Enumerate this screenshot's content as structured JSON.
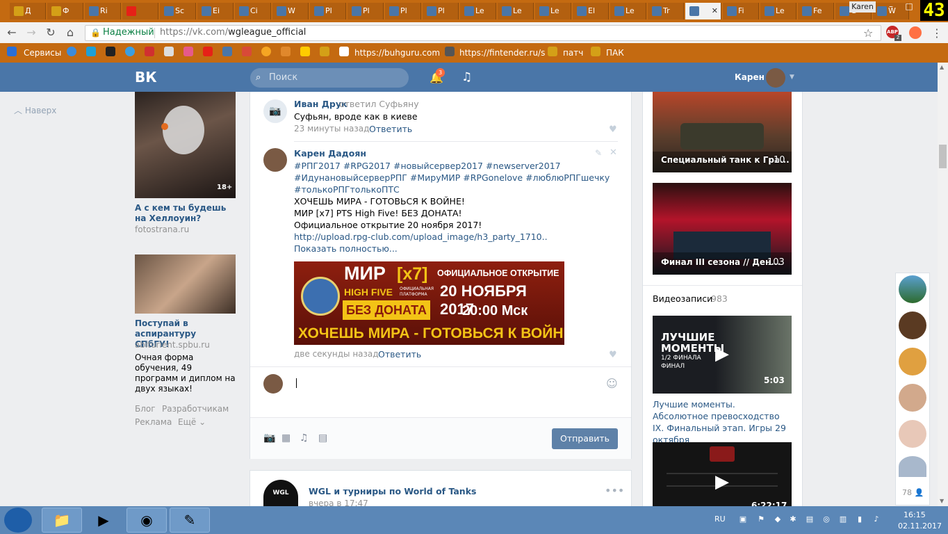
{
  "browser": {
    "tabs": [
      "Д",
      "Ф",
      "Rі",
      "",
      "Sc",
      "Ei",
      "Ci",
      "W",
      "Pl",
      "Pl",
      "Pl",
      "Pl",
      "Le",
      "Le",
      "Le",
      "El",
      "Le",
      "Tr",
      "",
      "Fi",
      "Le",
      "Fe",
      "G",
      "W"
    ],
    "window_user": "Karen",
    "corner_counter": "43",
    "secure_label": "Надежный",
    "url_host": "https://vk.com/",
    "url_path": "wgleague_official",
    "abp_badge": "ABP",
    "abp_count": "2"
  },
  "bookmarks": {
    "services": "Сервисы",
    "buhguru": "https://buhguru.com",
    "fintender": "https://fintender.ru/s",
    "patch": "патч",
    "pak": "ПАК"
  },
  "vk_header": {
    "logo": "ВК",
    "search_placeholder": "Поиск",
    "notif_count": "3",
    "user_name": "Карен"
  },
  "left": {
    "back_to_top": "Наверх",
    "ad1": {
      "badge": "18+",
      "title": "А с кем ты будешь на Хеллоуин?",
      "source": "fotostrana.ru"
    },
    "ad2": {
      "title": "Поступай в аспирантуру СПбГУ!",
      "source": "abiturient.spbu.ru",
      "body": "Очная форма обучения, 49 программ и диплом на двух языках!"
    },
    "footer": {
      "blog": "Блог",
      "dev": "Разработчикам",
      "ads": "Реклама",
      "more": "Ещё"
    }
  },
  "comments": {
    "c1": {
      "author": "Иван Друк",
      "action": "ответил Суфьяну",
      "text": "Суфьян, вроде как в киеве",
      "time": "23 минуты назад",
      "reply": "Ответить"
    },
    "c2": {
      "author": "Карен Дадоян",
      "tags1": "#РПГ2017 #RPG2017 #новыйсервер2017 #newserver2017",
      "tags2": "#ИдунановыйсерверРПГ #МируМИР #RPGonelove #люблюРПГшечку",
      "tags3": "#толькоРПГтолькоПТС",
      "line1": "ХОЧЕШЬ МИРА - ГОТОВЬСЯ К ВОЙНЕ!",
      "line2": "МИР [x7] PTS High Five! БЕЗ ДОНАТА!",
      "line3": "Официальное открытие 20 ноября 2017!",
      "link": "http://upload.rpg-club.com/upload_image/h3_party_1710..",
      "show_more": "Показать полностью...",
      "time": "две секунды назад",
      "reply": "Ответить"
    },
    "banner": {
      "mir": "МИР",
      "x7": "[x7]",
      "highfive": "HIGH FIVE",
      "platform": "ОФИЦИАЛЬНАЯ ПЛАТФОРМА",
      "no_donate": "БЕЗ ДОНАТА",
      "opening": "ОФИЦИАЛЬНОЕ ОТКРЫТИЕ",
      "date": "20 НОЯБРЯ 2017",
      "time": "20:00 Мск",
      "slogan": "ХОЧЕШЬ МИРА - ГОТОВЬСЯ К ВОЙНЕ"
    },
    "send_label": "Отправить"
  },
  "post2": {
    "author": "WGL и турниры по World of Tanks",
    "date": "вчера в 17:47",
    "logo_text": "WGL"
  },
  "right": {
    "album1": {
      "title": "Специальный танк к Гра...",
      "count": "10"
    },
    "album2": {
      "title": "Финал III сезона // Ден...",
      "count": "103"
    },
    "videos_title": "Видеозаписи",
    "videos_count": "983",
    "video1": {
      "overlay1": "ЛУЧШИЕ",
      "overlay2": "МОМЕНТЫ",
      "overlay3": "1/2 ФИНАЛА",
      "overlay4": "ФИНАЛ",
      "duration": "5:03",
      "caption": "Лучшие моменты. Абсолютное превосходство IX. Финальный этап. Игры 29 октября"
    },
    "video2": {
      "duration": "6:22:17"
    }
  },
  "friends_count": "78",
  "taskbar": {
    "lang": "RU",
    "time": "16:15",
    "date": "02.11.2017"
  }
}
